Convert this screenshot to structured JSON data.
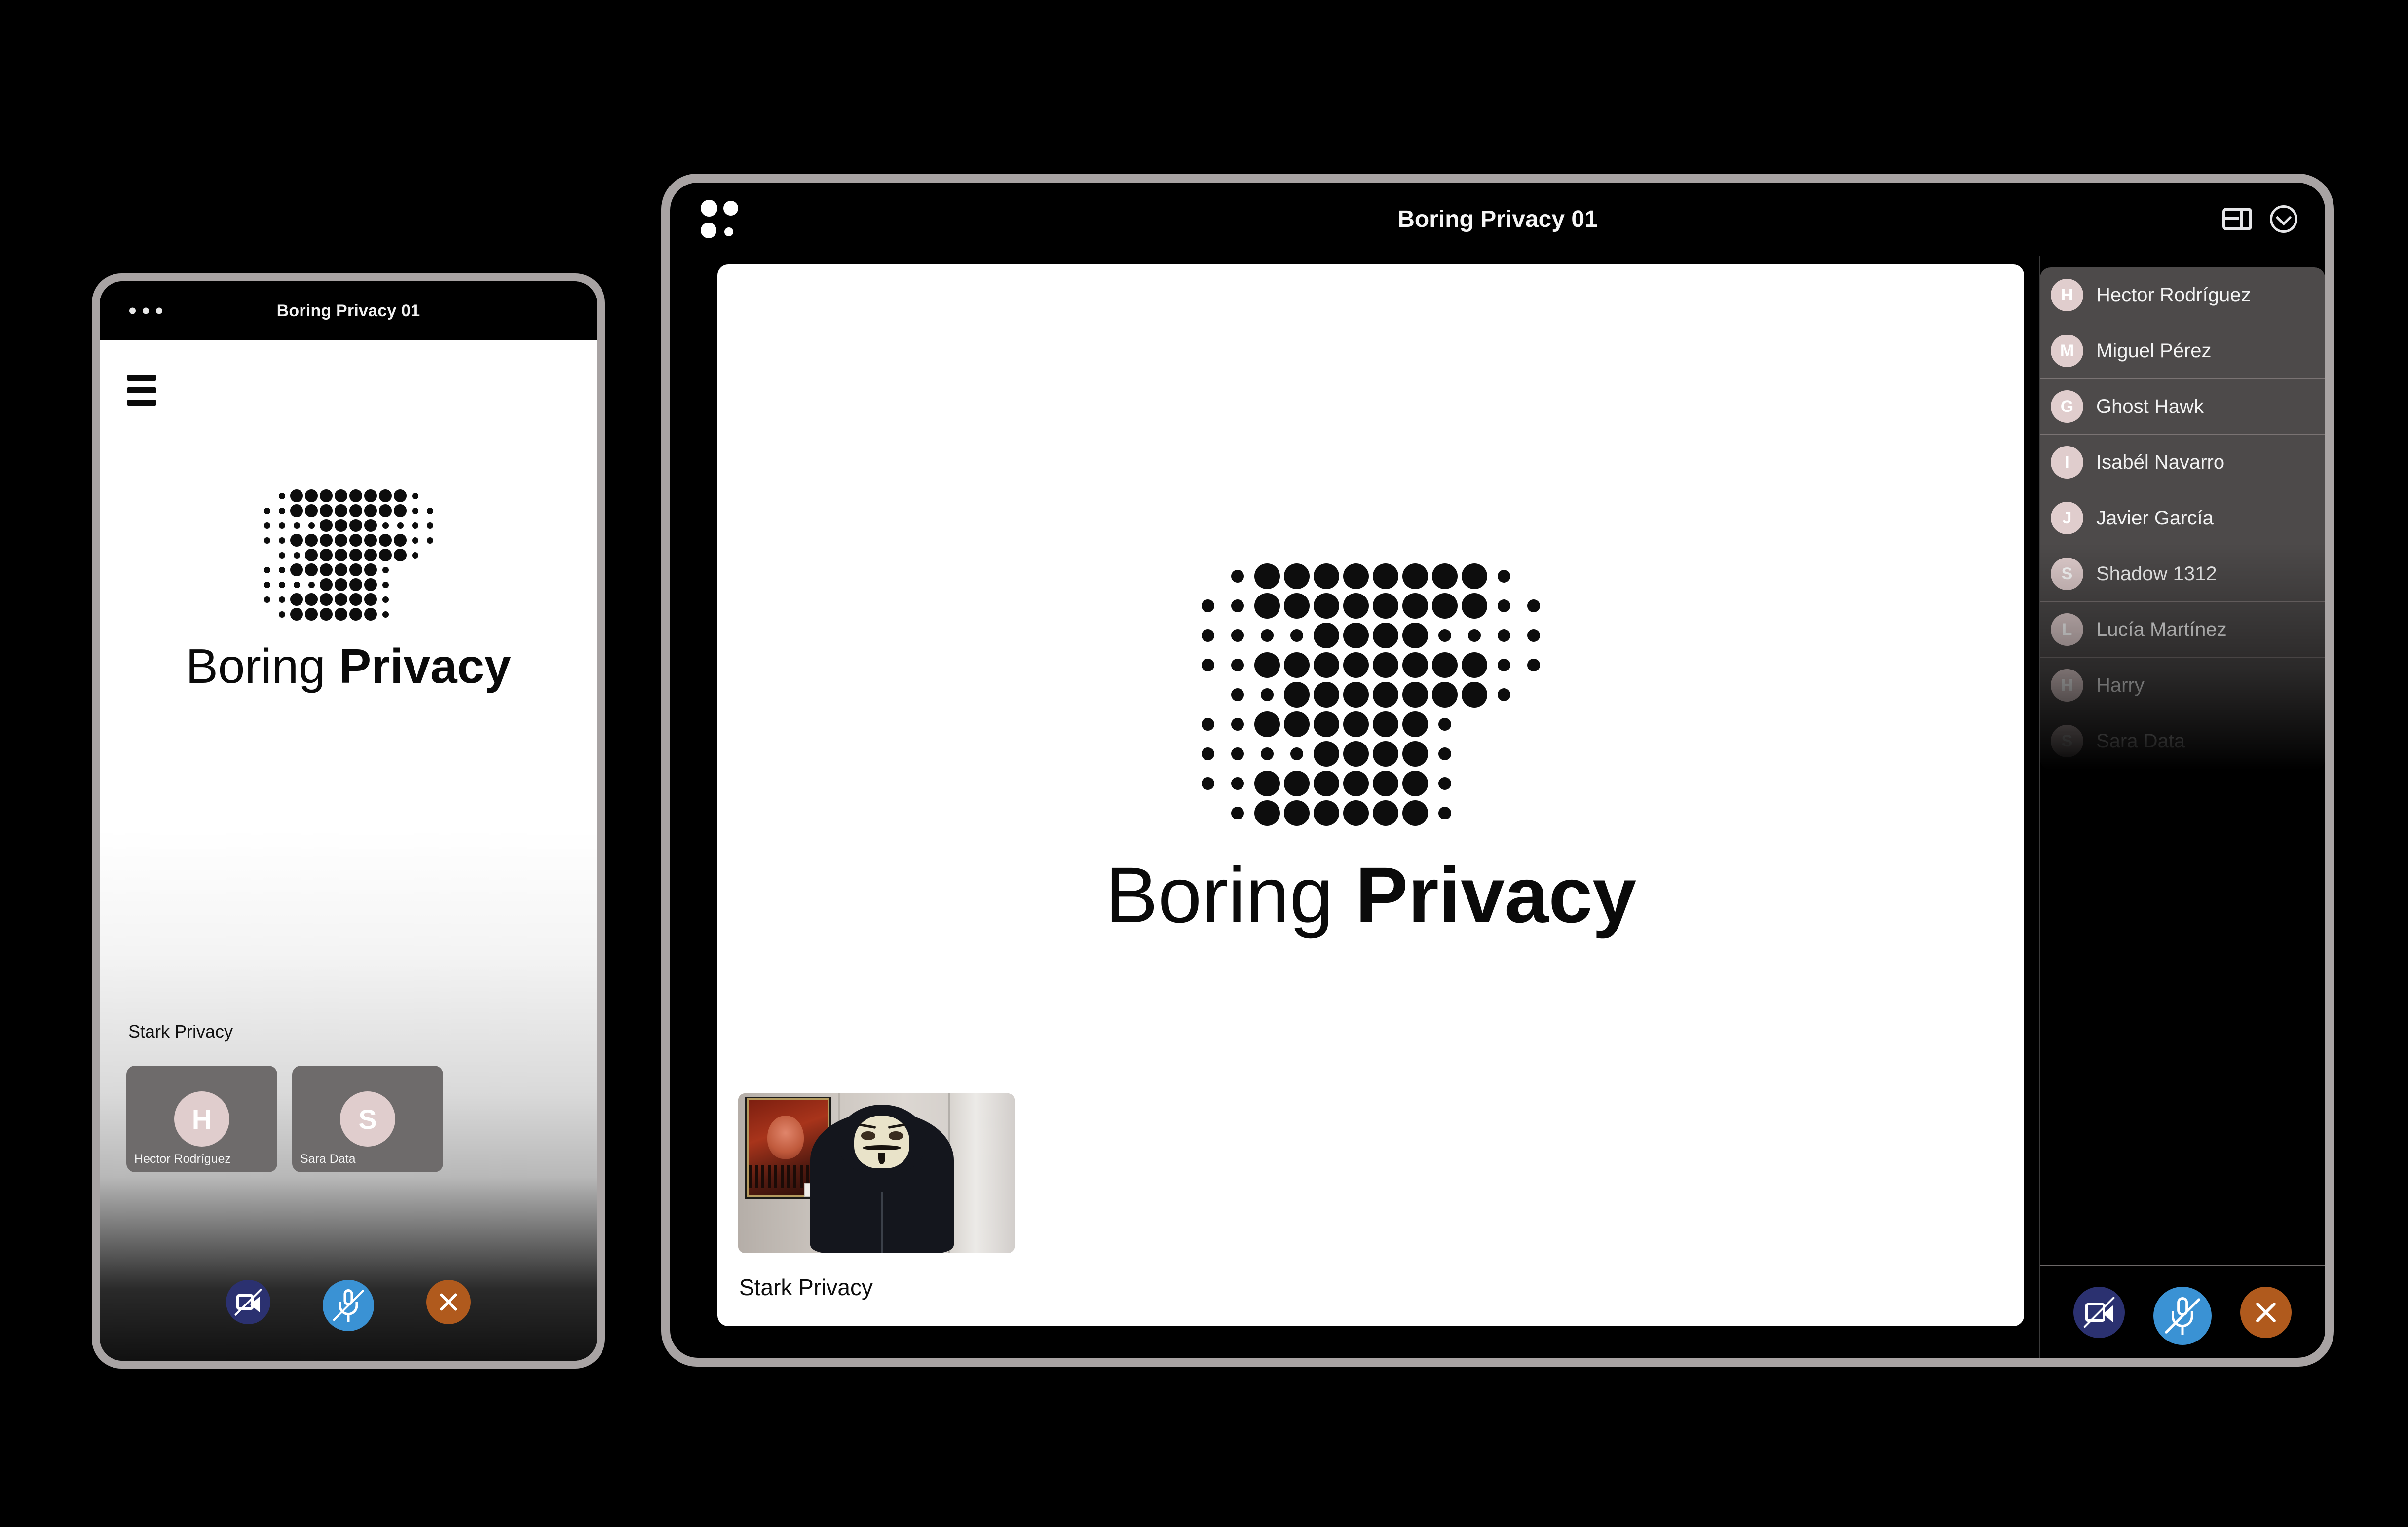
{
  "brand": {
    "wordmark_light": "Boring",
    "wordmark_bold": "Privacy",
    "logo_icon": "halftone-dots-logo"
  },
  "tablet": {
    "header": {
      "app_logo_icon": "four-dots-logo",
      "title": "Boring Privacy 01",
      "layout_icon": "layout-view-icon",
      "collapse_icon": "chevron-down-circle-icon"
    },
    "stage": {
      "self_label": "Stark Privacy",
      "thumbnail_icon": "self-video-thumbnail"
    },
    "participants": [
      {
        "initial": "H",
        "name": "Hector Rodríguez"
      },
      {
        "initial": "M",
        "name": "Miguel Pérez"
      },
      {
        "initial": "G",
        "name": "Ghost Hawk"
      },
      {
        "initial": "I",
        "name": "Isabél Navarro"
      },
      {
        "initial": "J",
        "name": "Javier García"
      },
      {
        "initial": "S",
        "name": "Shadow 1312"
      },
      {
        "initial": "L",
        "name": "Lucía Martínez"
      },
      {
        "initial": "H",
        "name": "Harry"
      },
      {
        "initial": "S",
        "name": "Sara Data"
      }
    ],
    "controls": [
      {
        "name": "camera-off-button",
        "icon": "video-camera-off-icon",
        "color": "#2b3170"
      },
      {
        "name": "microphone-off-button",
        "icon": "microphone-off-icon",
        "color": "#3a92d4"
      },
      {
        "name": "end-call-button",
        "icon": "close-x-icon",
        "color": "#b05a1d"
      }
    ]
  },
  "phone": {
    "header": {
      "menu_icon": "three-dots-menu-icon",
      "title": "Boring Privacy 01"
    },
    "hamburger_icon": "hamburger-menu-icon",
    "self_label": "Stark Privacy",
    "tiles": [
      {
        "initial": "H",
        "name": "Hector Rodríguez"
      },
      {
        "initial": "S",
        "name": "Sara Data"
      }
    ],
    "controls": [
      {
        "name": "camera-off-button",
        "icon": "video-camera-off-icon",
        "color": "#2b3170"
      },
      {
        "name": "microphone-off-button",
        "icon": "microphone-off-icon",
        "color": "#3a92d4"
      },
      {
        "name": "end-call-button",
        "icon": "close-x-icon",
        "color": "#b05a1d"
      }
    ]
  },
  "colors": {
    "background": "#000000",
    "device_frame": "#a8a3a3",
    "avatar_pink": "#e0cdcd",
    "row_bg": "#4d4a4a",
    "camera_off": "#2b3170",
    "mic_off": "#3a92d4",
    "end_call": "#b05a1d"
  }
}
